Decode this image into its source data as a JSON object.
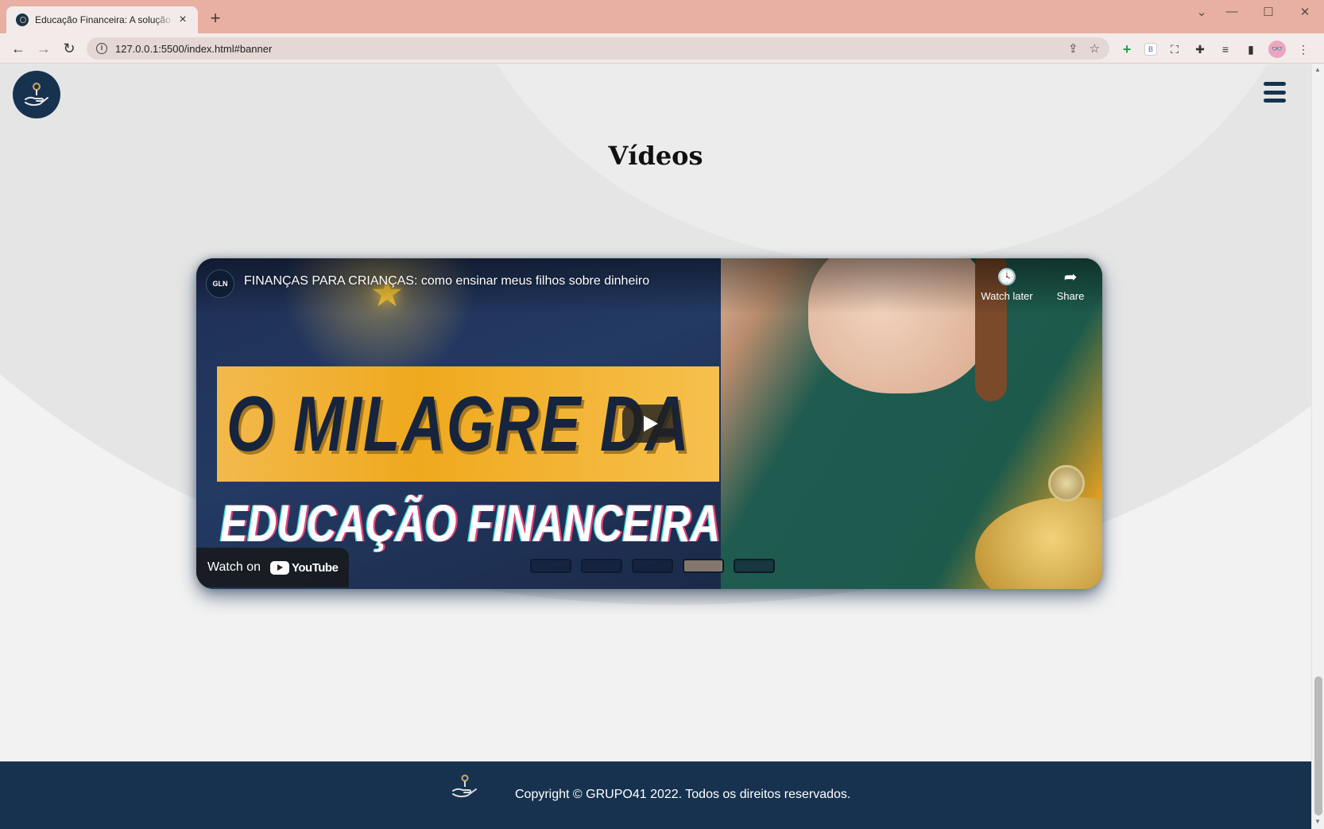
{
  "browser": {
    "tab_title": "Educação Financeira: A solução c",
    "tab_close": "×",
    "new_tab": "+",
    "url": "127.0.0.1:5500/index.html#banner",
    "window_controls": [
      "⌄",
      "—",
      "☐",
      "✕"
    ]
  },
  "page": {
    "section_title": "Vídeos"
  },
  "video": {
    "title": "FINANÇAS PARA CRIANÇAS: como ensinar meus filhos sobre dinheiro",
    "channel_badge": "GLN",
    "watch_later": "Watch later",
    "share": "Share",
    "watch_on": "Watch on",
    "youtube": "YouTube",
    "thumbnail_line1": "O MILAGRE DA",
    "thumbnail_line2": "EDUCAÇÃO FINANCEIRA"
  },
  "footer": {
    "copyright": "Copyright © GRUPO41 2022. Todos os direitos reservados."
  },
  "icons": [
    "logo-hand-coin-icon",
    "hamburger-menu-icon",
    "play-icon",
    "clock-icon",
    "share-icon",
    "youtube-icon"
  ],
  "colors": {
    "brand_navy": "#17324f",
    "tab_strip": "#e8b0a2",
    "page_bg": "#f2f2f2"
  }
}
